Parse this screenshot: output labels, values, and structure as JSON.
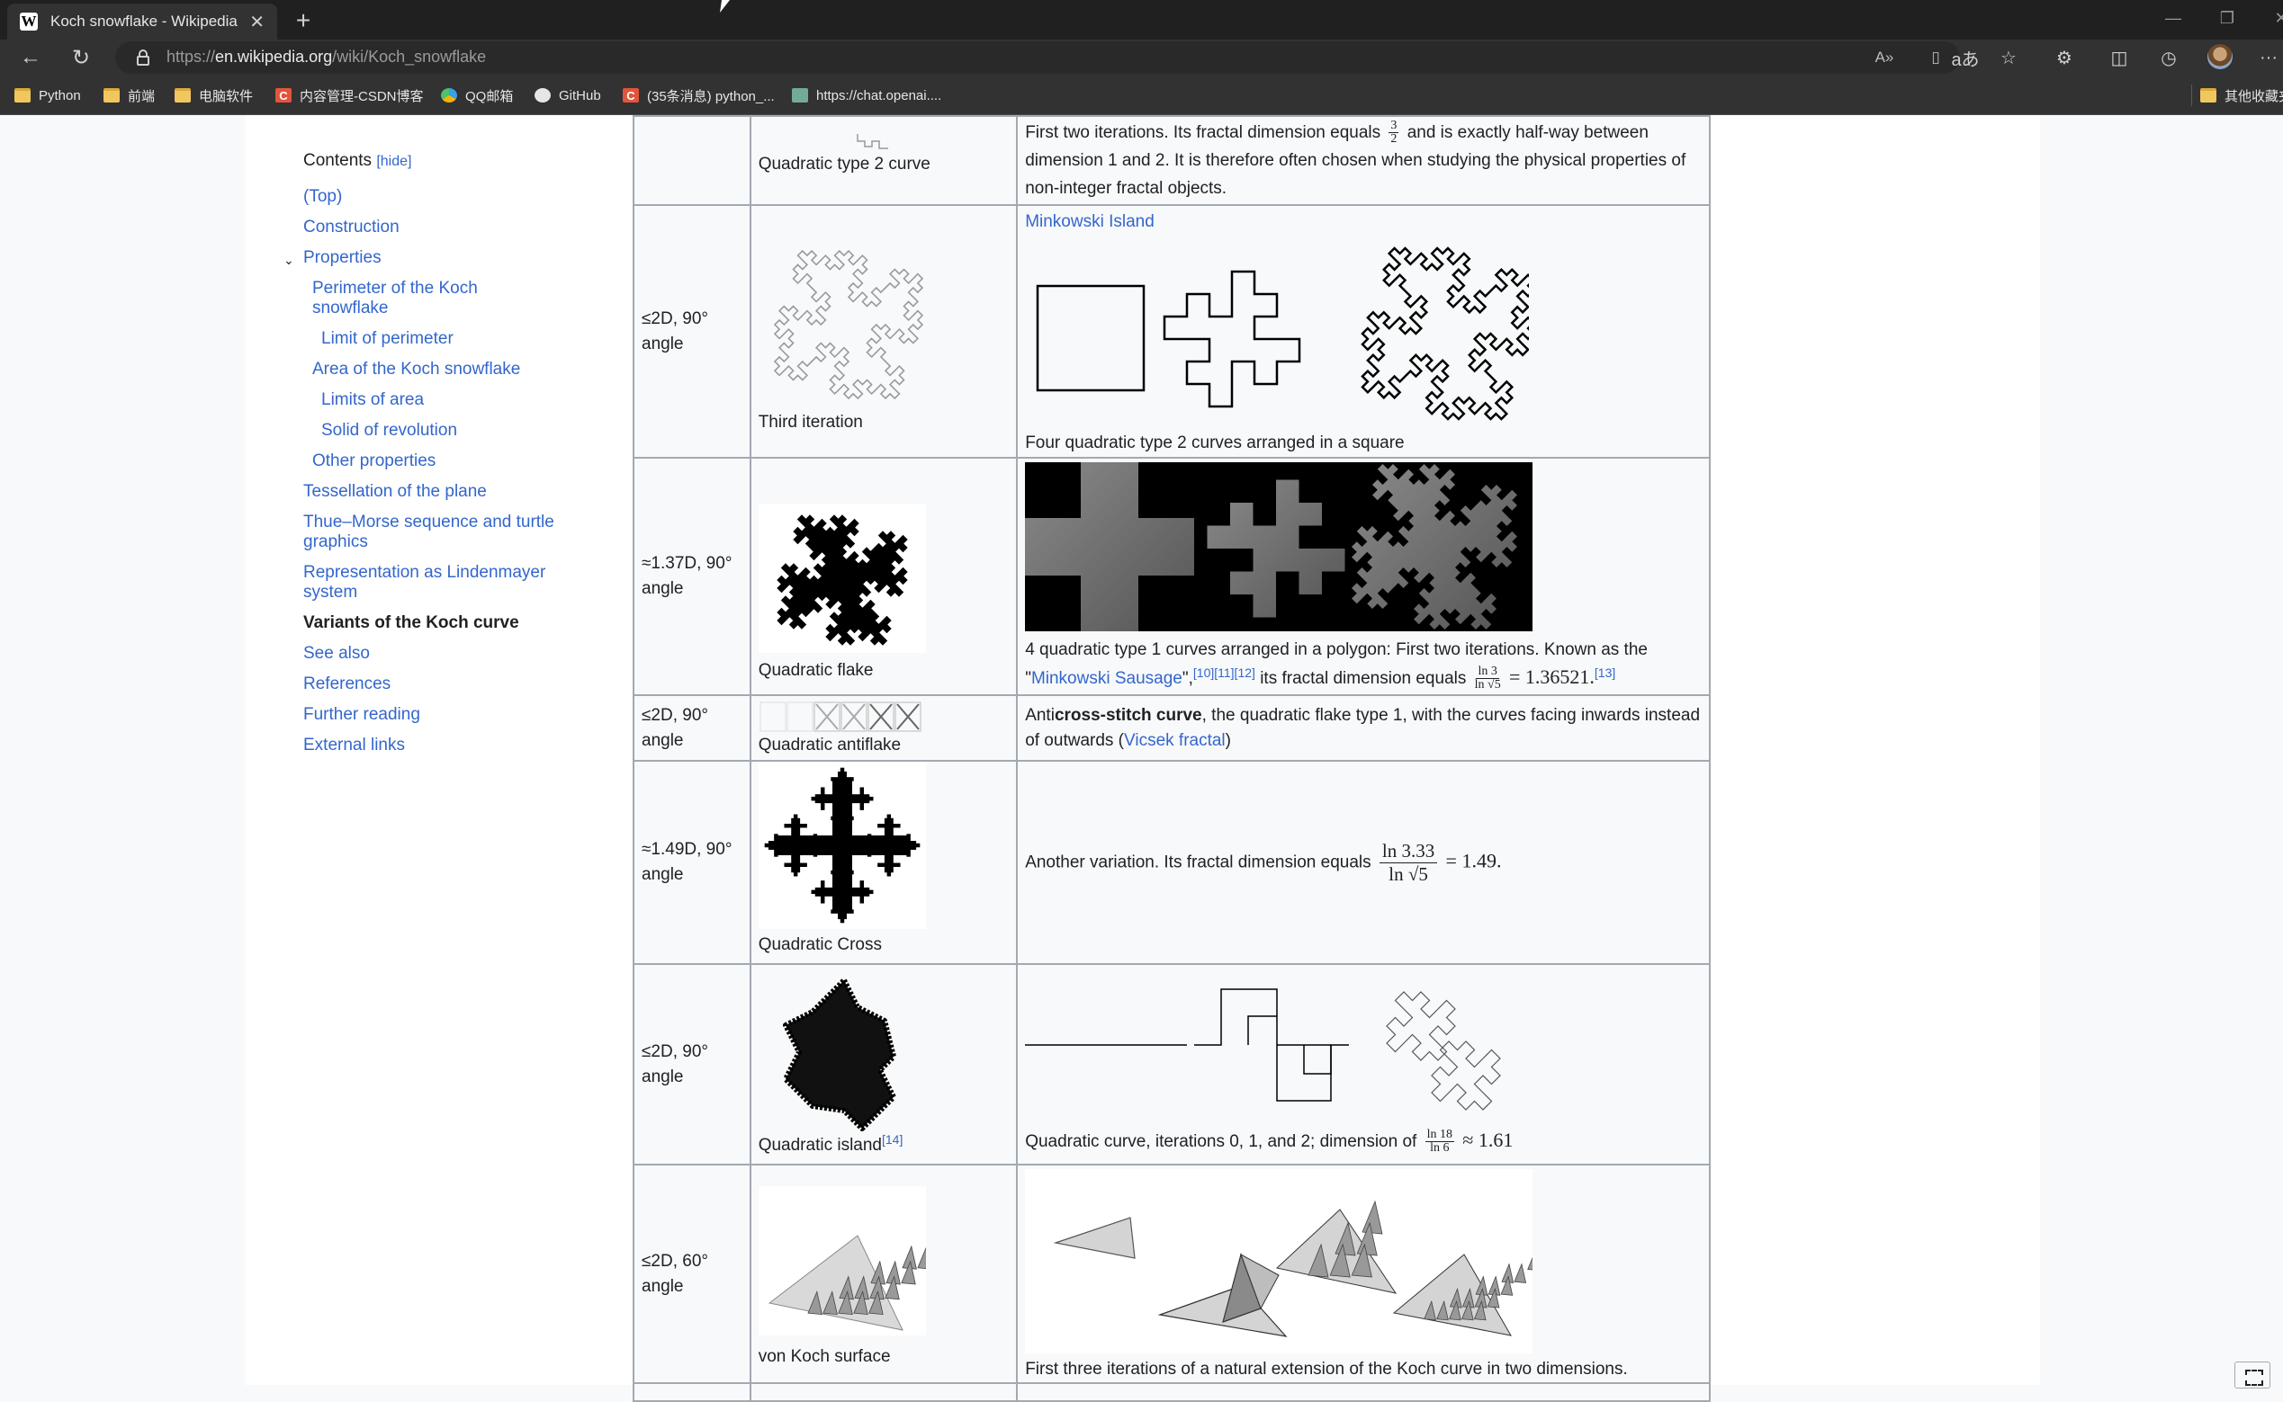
{
  "browser": {
    "tab_title": "Koch snowflake - Wikipedia",
    "tab_favicon": "W",
    "url_scheme": "https://",
    "url_host": "en.wikipedia.org",
    "url_path": "/wiki/Koch_snowflake",
    "bookmarks": [
      {
        "label": "Python",
        "icon": "folder-icon"
      },
      {
        "label": "前端",
        "icon": "folder-icon"
      },
      {
        "label": "电脑软件",
        "icon": "folder-icon"
      },
      {
        "label": "内容管理-CSDN博客",
        "icon": "csdn-icon"
      },
      {
        "label": "QQ邮箱",
        "icon": "qq-mail-icon"
      },
      {
        "label": "GitHub",
        "icon": "github-icon"
      },
      {
        "label": "(35条消息) python_...",
        "icon": "csdn-icon"
      },
      {
        "label": "https://chat.openai....",
        "icon": "openai-icon"
      }
    ],
    "other_bookmarks": "其他收藏夹"
  },
  "toc": {
    "title": "Contents",
    "hide_label": "[hide]",
    "items": [
      {
        "label": "(Top)",
        "level": 1
      },
      {
        "label": "Construction",
        "level": 1
      },
      {
        "label": "Properties",
        "level": 1
      },
      {
        "label": "Perimeter of the Koch snowflake",
        "level": 2
      },
      {
        "label": "Limit of perimeter",
        "level": 3
      },
      {
        "label": "Area of the Koch snowflake",
        "level": 2
      },
      {
        "label": "Limits of area",
        "level": 3
      },
      {
        "label": "Solid of revolution",
        "level": 3
      },
      {
        "label": "Other properties",
        "level": 2
      },
      {
        "label": "Tessellation of the plane",
        "level": 1
      },
      {
        "label": "Thue–Morse sequence and turtle graphics",
        "level": 1
      },
      {
        "label": "Representation as Lindenmayer system",
        "level": 1
      },
      {
        "label": "Variants of the Koch curve",
        "level": 1,
        "active": true
      },
      {
        "label": "See also",
        "level": 1
      },
      {
        "label": "References",
        "level": 1
      },
      {
        "label": "Further reading",
        "level": 1
      },
      {
        "label": "External links",
        "level": 1
      }
    ]
  },
  "variants": [
    {
      "dimension": "",
      "name": "Quadratic type 2 curve",
      "text1": "First two iterations. Its fractal dimension equals",
      "frac_num": "3",
      "frac_den": "2",
      "text2": "and is exactly half-way between dimension 1 and 2. It is therefore often chosen when studying the physical properties of non-integer fractal objects."
    },
    {
      "dimension": "≤2D, 90° angle",
      "name": "Third iteration",
      "link": "Minkowski Island",
      "caption": "Four quadratic type 2 curves arranged in a square"
    },
    {
      "dimension": "≈1.37D, 90° angle",
      "name": "Quadratic flake",
      "text1": "4 quadratic type 1 curves arranged in a polygon: First two iterations. Known as the \"",
      "link": "Minkowski Sausage",
      "text2": "\",",
      "refs": "[10][11][12]",
      "text3": "its fractal dimension equals",
      "frac_num": "ln 3",
      "frac_den": "ln √5",
      "result": "= 1.36521.",
      "ref2": "[13]"
    },
    {
      "dimension": "≤2D, 90° angle",
      "name": "Quadratic antiflake",
      "text_prefix": "Anti",
      "text_bold": "cross-stitch curve",
      "text_mid": ", the quadratic flake type 1, with the curves facing inwards instead of outwards (",
      "link": "Vicsek fractal",
      "text_end": ")"
    },
    {
      "dimension": "≈1.49D, 90° angle",
      "name": "Quadratic Cross",
      "text1": "Another variation. Its fractal dimension equals",
      "frac_num": "ln 3.33",
      "frac_den": "ln √5",
      "result": "= 1.49."
    },
    {
      "dimension": "≤2D, 90° angle",
      "name": "Quadratic island",
      "ref": "[14]",
      "text1": "Quadratic curve, iterations 0, 1, and 2; dimension of",
      "frac_num": "ln 18",
      "frac_den": "ln 6",
      "result": "≈ 1.61"
    },
    {
      "dimension": "≤2D, 60° angle",
      "name": "von Koch surface",
      "caption": "First three iterations of a natural extension of the Koch curve in two dimensions."
    }
  ]
}
